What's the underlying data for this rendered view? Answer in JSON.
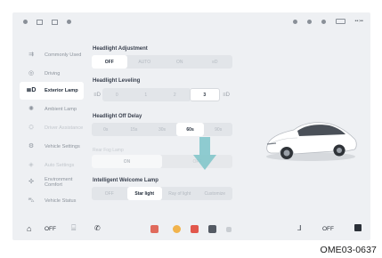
{
  "sidebar": {
    "items": [
      {
        "label": "Commonly Used",
        "icon": "sliders-icon"
      },
      {
        "label": "Driving",
        "icon": "steering-wheel-icon"
      },
      {
        "label": "Exterior Lamp",
        "icon": "headlamp-icon",
        "active": true
      },
      {
        "label": "Ambient Lamp",
        "icon": "ambient-lamp-icon"
      },
      {
        "label": "Driver Assistance",
        "icon": "driver-assist-icon",
        "faded": true
      },
      {
        "label": "Vehicle Settings",
        "icon": "car-settings-icon"
      },
      {
        "label": "Auto Settings",
        "icon": "auto-icon",
        "faded": true
      },
      {
        "label": "Environment Comfort",
        "icon": "fan-icon"
      },
      {
        "label": "Vehicle Status",
        "icon": "vehicle-status-icon"
      }
    ]
  },
  "headlight_adjustment": {
    "title": "Headlight Adjustment",
    "options": [
      "OFF",
      "AUTO",
      "ON",
      "≡D"
    ],
    "selected": 0
  },
  "headlight_leveling": {
    "title": "Headlight Leveling",
    "options": [
      "0",
      "1",
      "2",
      "3"
    ],
    "selected": 3
  },
  "headlight_off_delay": {
    "title": "Headlight Off Delay",
    "options": [
      "0s",
      "15s",
      "30s",
      "60s",
      "90s"
    ],
    "selected": 3
  },
  "rear_fog": {
    "title": "Rear Fog Lamp",
    "options": [
      "ON",
      "OFF"
    ]
  },
  "welcome_lamp": {
    "title": "Intelligent Welcome Lamp",
    "options": [
      "OFF",
      "Star light",
      "Ray of light",
      "Customize"
    ],
    "selected": 1
  },
  "bottom_bar": {
    "left_temp": "OFF",
    "right_temp": "OFF"
  },
  "caption": "OME03-0637"
}
